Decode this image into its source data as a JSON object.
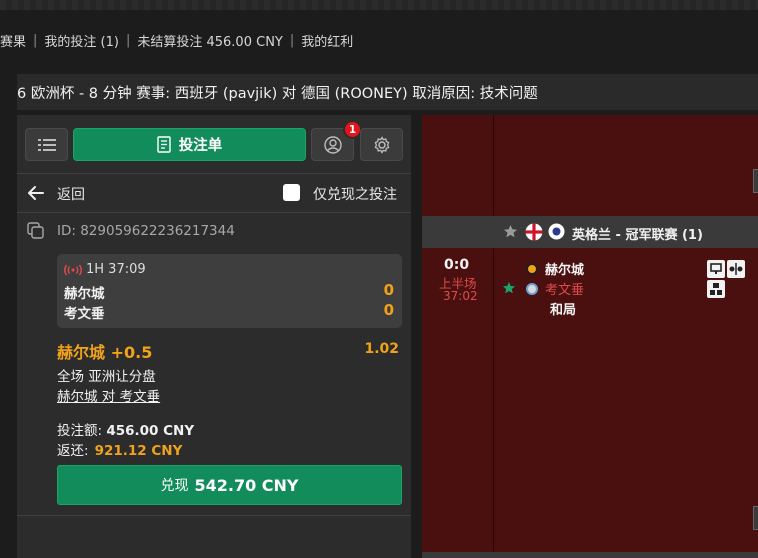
{
  "topnav": {
    "items": [
      "赛果",
      "我的投注 (1)",
      "未结算投注 456.00 CNY",
      "我的红利"
    ]
  },
  "announcement": "6 欧洲杯 - 8 分钟 赛事: 西班牙 (pavjik) 对 德国 (ROONEY) 取消原因: 技术问题",
  "betslip": {
    "main_button": "投注单",
    "badge_count": "1",
    "back_label": "返回",
    "only_cashout_label": "仅兑现之投注",
    "bet_id": "ID: 829059622236217344",
    "live_time": "1H 37:09",
    "home_team": "赫尔城",
    "away_team": "考文垂",
    "home_score": "0",
    "away_score": "0",
    "selection": "赫尔城",
    "handicap": "+0.5",
    "odds": "1.02",
    "market": "全场 亚洲让分盘",
    "event": "赫尔城 对 考文垂",
    "stake_label": "投注额:",
    "stake_value": "456.00 CNY",
    "returns_label": "返还:",
    "returns_value": "921.12 CNY",
    "cashout_label": "兑现",
    "cashout_value": "542.70 CNY"
  },
  "right_panel": {
    "league": "英格兰 - 冠军联赛 (1)",
    "score": "0:0",
    "period": "上半场",
    "time": "37:02",
    "home_team": "赫尔城",
    "away_team": "考文垂",
    "draw": "和局"
  },
  "colors": {
    "accent_green": "#128c5a",
    "odds_orange": "#f0a21b",
    "live_red": "#e04a4a",
    "panel_red": "#4a1010"
  }
}
